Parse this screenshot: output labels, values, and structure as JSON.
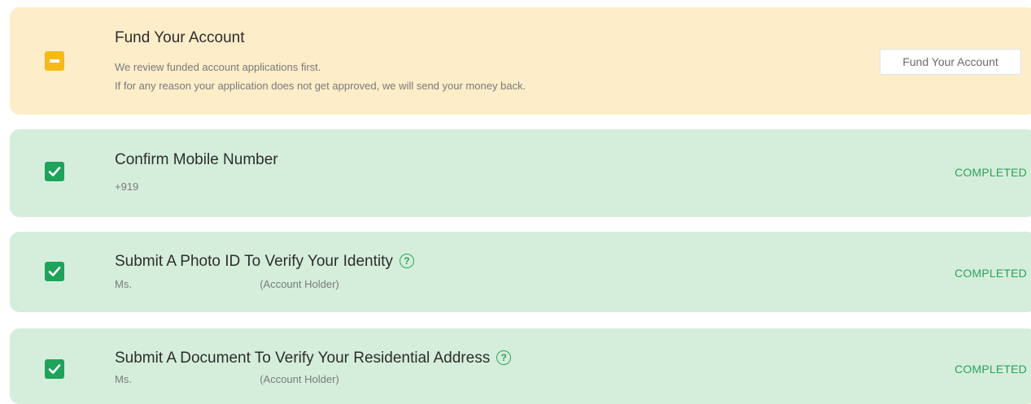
{
  "steps": {
    "fund": {
      "title": "Fund Your Account",
      "line1": "We review funded account applications first.",
      "line2": "If for any reason your application does not get approved, we will send your money back.",
      "button_label": "Fund Your Account",
      "status": "pending"
    },
    "mobile": {
      "title": "Confirm Mobile Number",
      "phone": "+919",
      "status_label": "COMPLETED"
    },
    "photo_id": {
      "title": "Submit A Photo ID To Verify Your Identity",
      "holder_prefix": "Ms.",
      "holder_suffix": "(Account Holder)",
      "status_label": "COMPLETED"
    },
    "address": {
      "title": "Submit A Document To Verify Your Residential Address",
      "holder_prefix": "Ms.",
      "holder_suffix": "(Account Holder)",
      "status_label": "COMPLETED"
    }
  },
  "help_glyph": "?",
  "colors": {
    "pending_bg": "#fdedc9",
    "pending_icon": "#f6b915",
    "done_bg": "#d5eedb",
    "done_icon": "#1ea35a",
    "completed_text": "#2ba25a"
  },
  "icons": {
    "pending": "minus-square-icon",
    "done": "check-square-icon",
    "help": "question-circle-icon"
  }
}
